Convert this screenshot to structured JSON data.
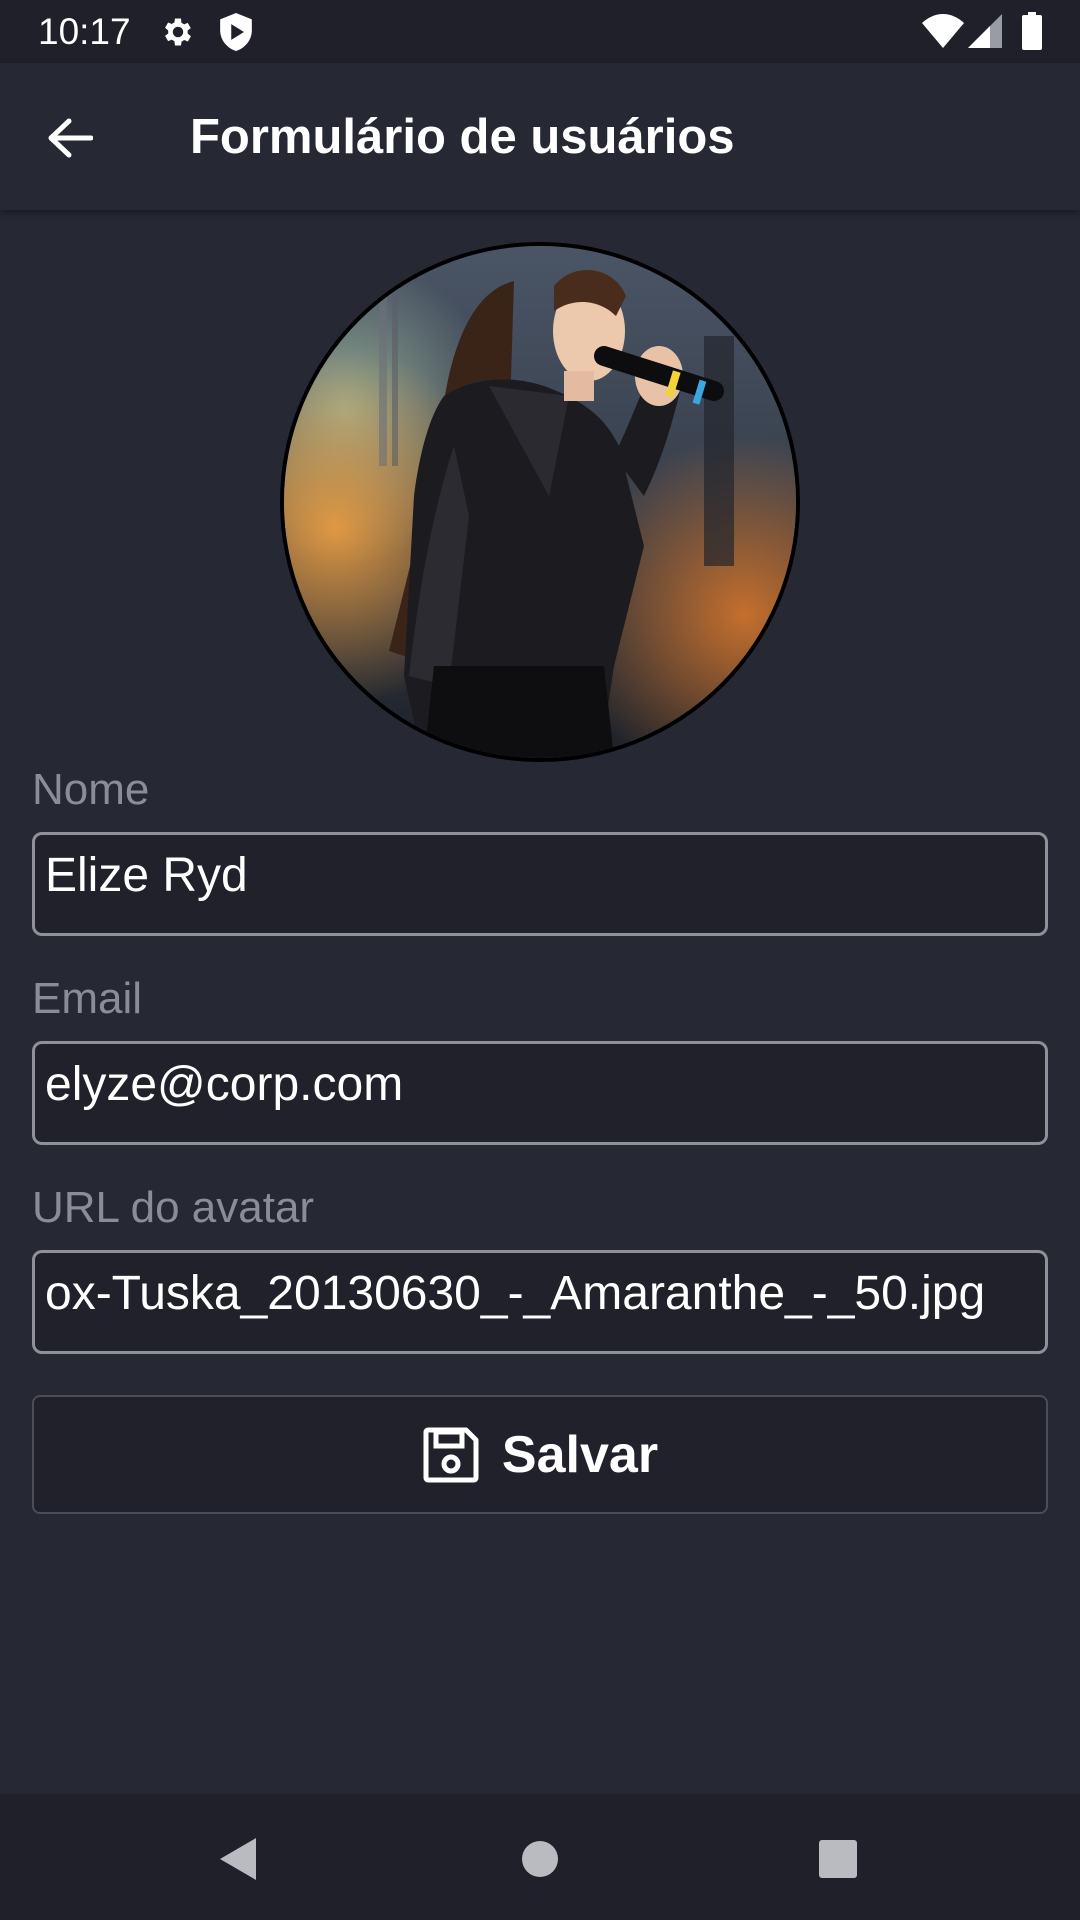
{
  "status_bar": {
    "time": "10:17",
    "icons": [
      "gear-icon",
      "shield-icon",
      "wifi-icon",
      "cell-signal-icon",
      "battery-icon"
    ]
  },
  "app_bar": {
    "back_icon": "arrow-left-icon",
    "title": "Formulário de usuários"
  },
  "avatar": {
    "description_icon": "user-avatar-photo"
  },
  "form": {
    "name": {
      "label": "Nome",
      "value": "Elize Ryd"
    },
    "email": {
      "label": "Email",
      "value": "elyze@corp.com"
    },
    "avatar_url": {
      "label": "URL do avatar",
      "value": "ox-Tuska_20130630_-_Amaranthe_-_50.jpg"
    },
    "save_button": {
      "icon": "floppy-disk-icon",
      "label": "Salvar"
    }
  },
  "nav_bar": {
    "back": "nav-back-icon",
    "home": "nav-home-icon",
    "recents": "nav-recents-icon"
  },
  "colors": {
    "background": "#262834",
    "bar_background": "#1f2029",
    "input_background": "#20212b",
    "label_color": "#8a8d96",
    "border_color": "#8f9199"
  }
}
